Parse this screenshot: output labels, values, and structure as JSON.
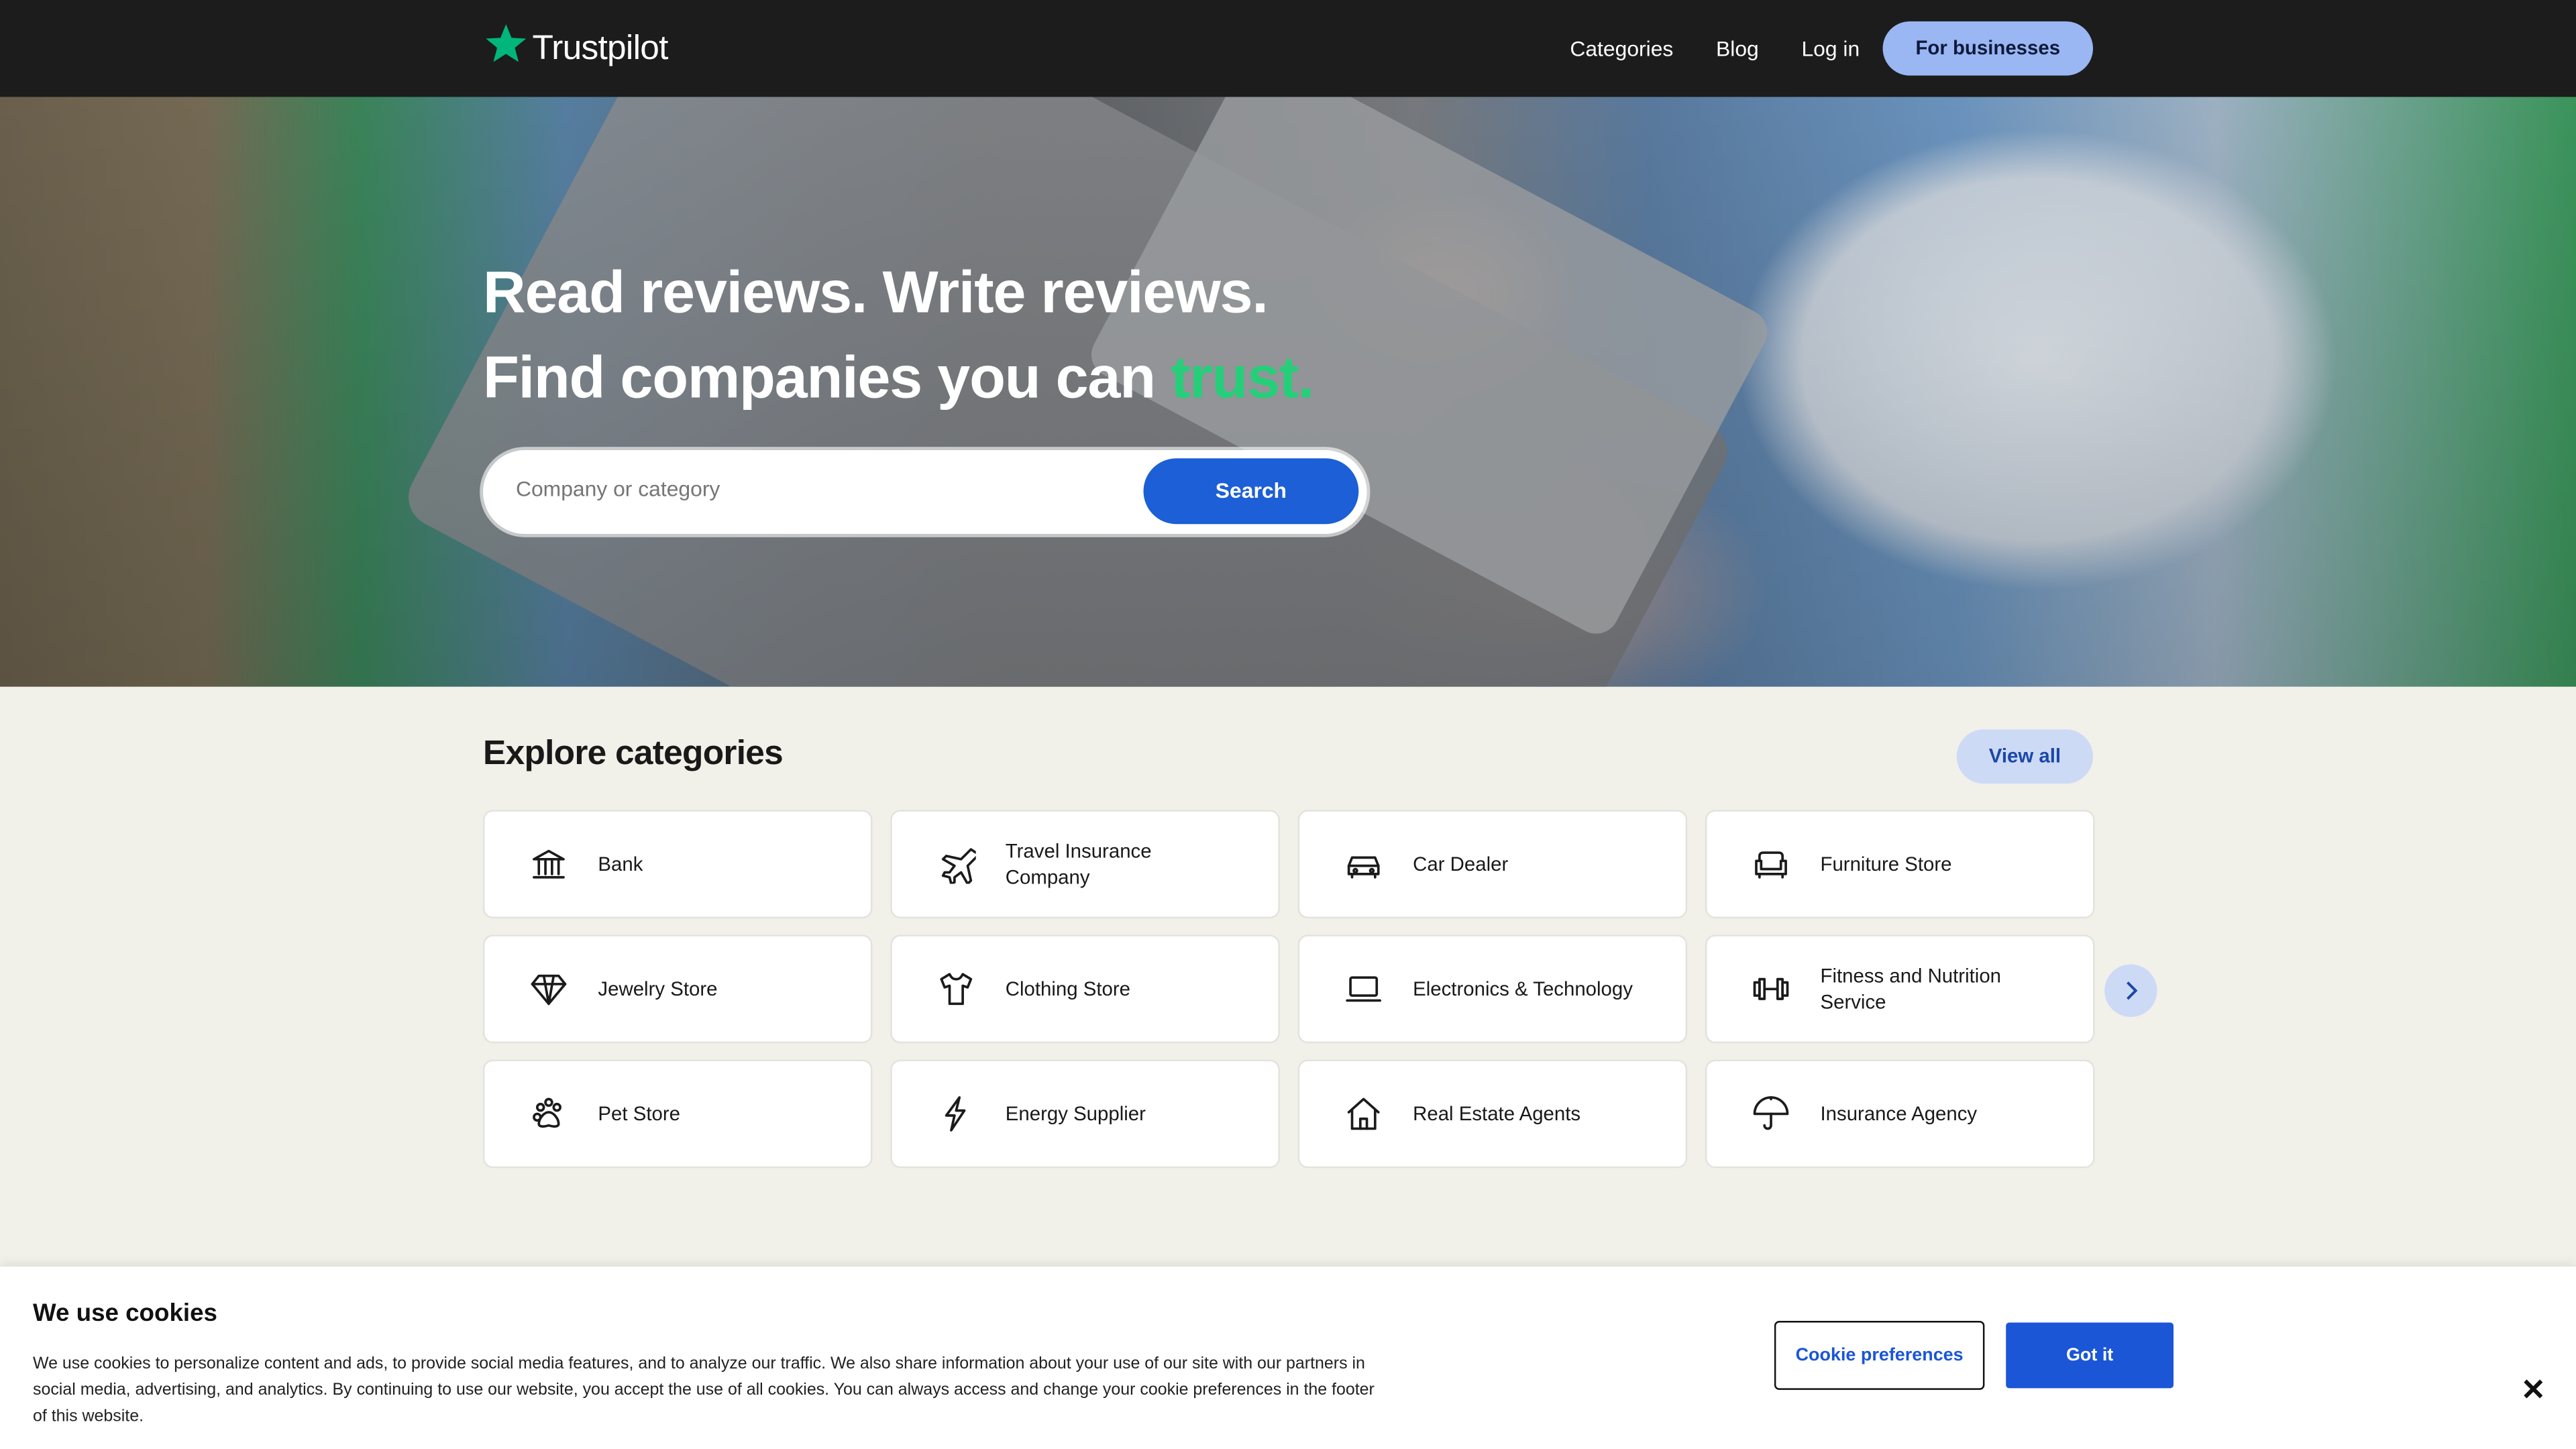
{
  "header": {
    "logo_text": "Trustpilot",
    "nav": {
      "categories": "Categories",
      "blog": "Blog",
      "login": "Log in",
      "for_businesses": "For businesses"
    }
  },
  "hero": {
    "line1": "Read reviews. Write reviews.",
    "line2_prefix": "Find companies you can ",
    "line2_accent": "trust.",
    "search": {
      "placeholder": "Company or category",
      "button_label": "Search"
    }
  },
  "categories": {
    "title": "Explore categories",
    "view_all_label": "View all",
    "items": [
      {
        "label": "Bank",
        "icon": "bank-icon"
      },
      {
        "label": "Travel Insurance Company",
        "icon": "airplane-icon"
      },
      {
        "label": "Car Dealer",
        "icon": "car-icon"
      },
      {
        "label": "Furniture Store",
        "icon": "sofa-icon"
      },
      {
        "label": "Jewelry Store",
        "icon": "diamond-icon"
      },
      {
        "label": "Clothing Store",
        "icon": "shirt-icon"
      },
      {
        "label": "Electronics & Technology",
        "icon": "laptop-icon"
      },
      {
        "label": "Fitness and Nutrition Service",
        "icon": "dumbbell-icon"
      },
      {
        "label": "Pet Store",
        "icon": "paw-icon"
      },
      {
        "label": "Energy Supplier",
        "icon": "lightning-icon"
      },
      {
        "label": "Real Estate Agents",
        "icon": "house-icon"
      },
      {
        "label": "Insurance Agency",
        "icon": "umbrella-icon"
      }
    ]
  },
  "cookie_banner": {
    "title": "We use cookies",
    "text": "We use cookies to personalize content and ads, to provide social media features, and to analyze our traffic. We also share information about your use of our site with our partners in social media, advertising, and analytics. By continuing to use our website, you accept the use of all cookies. You can always access and change your cookie preferences in the footer of this website.",
    "preferences_label": "Cookie preferences",
    "accept_label": "Got it",
    "close_label": "✕"
  },
  "colors": {
    "header_bg": "#1c1c1c",
    "accent_green": "#25cf7a",
    "primary_blue": "#1c5fd6",
    "light_blue": "#ccdaf6",
    "page_bg": "#f1f0e9"
  }
}
